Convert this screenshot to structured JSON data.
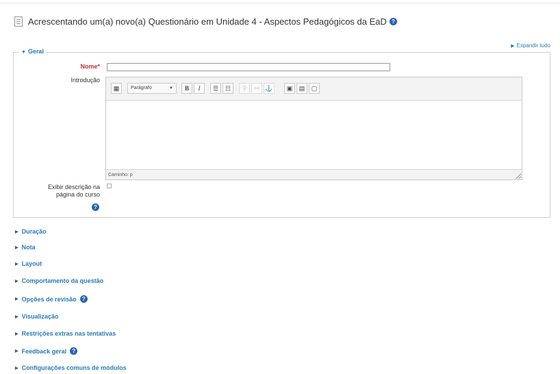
{
  "page": {
    "title": "Acrescentando um(a) novo(a) Questionário em Unidade 4 - Aspectos Pedagógicos da EaD"
  },
  "expand_all_label": "Expandir tudo",
  "geral": {
    "legend": "Geral",
    "nome_label": "Nome",
    "required_marker": "*",
    "nome_value": "",
    "introducao_label": "Introdução",
    "editor": {
      "format_select": "Parágrafo",
      "path_label": "Caminho: p",
      "content": ""
    },
    "exibir_label_line1": "Exibir descrição na",
    "exibir_label_line2": "página do curso",
    "exibir_checked": false
  },
  "sections": [
    {
      "label": "Duração",
      "help": false
    },
    {
      "label": "Nota",
      "help": false
    },
    {
      "label": "Layout",
      "help": false
    },
    {
      "label": "Comportamento da questão",
      "help": false
    },
    {
      "label": "Opções de revisão",
      "help": true
    },
    {
      "label": "Visualização",
      "help": false
    },
    {
      "label": "Restrições extras nas tentativas",
      "help": false
    },
    {
      "label": "Feedback geral",
      "help": true
    },
    {
      "label": "Configurações comuns de módulos",
      "help": false
    }
  ],
  "colors": {
    "link": "#2a7bb6",
    "required": "#b33333",
    "help_icon": "#2a63ad"
  },
  "icons": {
    "collapsed": "triangle-right",
    "expanded": "triangle-down",
    "help": "question-circle"
  }
}
